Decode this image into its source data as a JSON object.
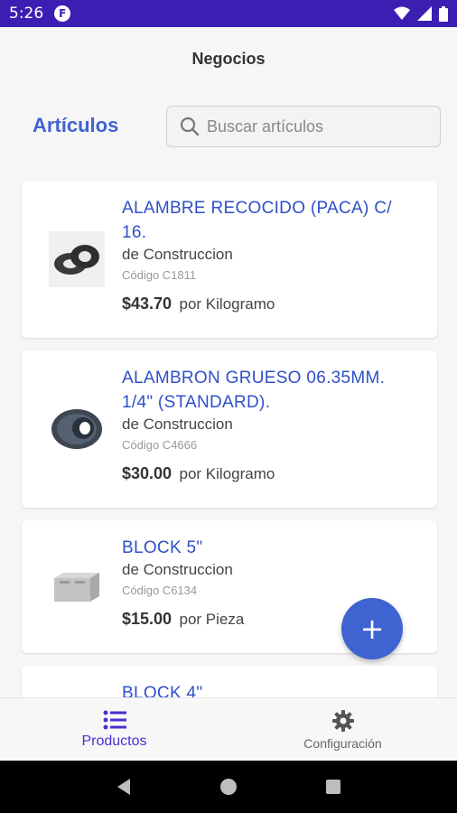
{
  "status_bar": {
    "time": "5:26",
    "app_badge": "F"
  },
  "header": {
    "title": "Negocios"
  },
  "section": {
    "title": "Artículos"
  },
  "search": {
    "placeholder": "Buscar artículos"
  },
  "products": [
    {
      "name": "ALAMBRE RECOCIDO (PACA) C/ 16.",
      "category": "de Construccion",
      "code": "Código C1811",
      "price": "$43.70",
      "unit": "por Kilogramo",
      "icon": "wire-roll-image"
    },
    {
      "name": "ALAMBRON GRUESO 06.35MM. 1/4\" (STANDARD).",
      "category": "de Construccion",
      "code": "Código C4666",
      "price": "$30.00",
      "unit": "por Kilogramo",
      "icon": "wire-coil-image"
    },
    {
      "name": "BLOCK  5\"",
      "category": "de Construccion",
      "code": "Código C6134",
      "price": "$15.00",
      "unit": "por Pieza",
      "icon": "concrete-block-image"
    },
    {
      "name": "BLOCK 4\""
    }
  ],
  "fab": {
    "label": "+"
  },
  "bottom_nav": {
    "tabs": [
      {
        "label": "Productos",
        "icon": "list-icon",
        "active": true
      },
      {
        "label": "Configuración",
        "icon": "gear-icon",
        "active": false
      }
    ]
  },
  "colors": {
    "accent": "#3f63d0",
    "status_bar": "#3b1fb3",
    "active_tab": "#4b2fd0"
  }
}
